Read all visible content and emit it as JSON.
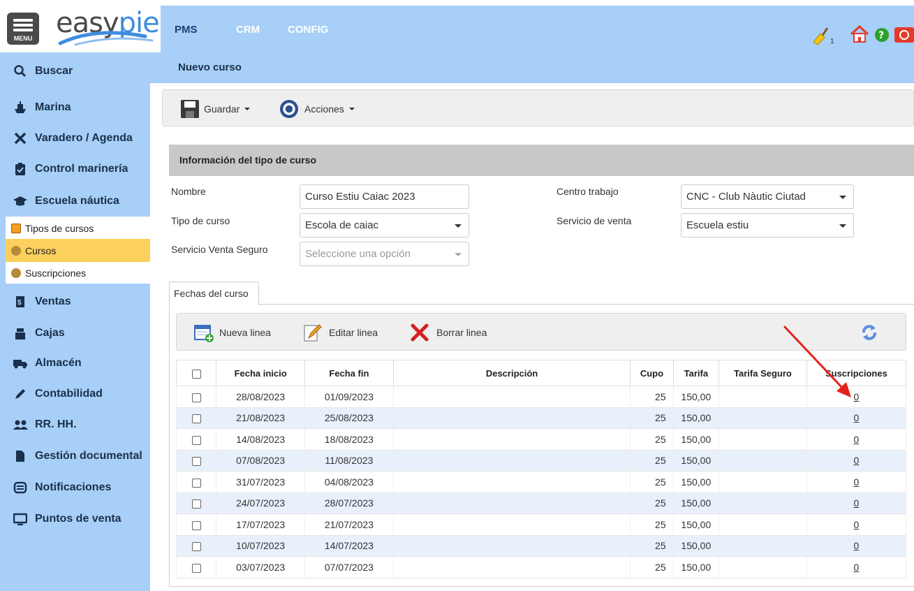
{
  "app": {
    "menu_label": "MENU",
    "logo_part1": "easy",
    "logo_part2": "pier",
    "modules": [
      "PMS",
      "CRM",
      "CONFIG"
    ],
    "notification_count": "1"
  },
  "sidebar": {
    "items": [
      {
        "label": "Buscar",
        "icon": "search-icon"
      },
      {
        "label": "Marina",
        "icon": "ship-icon"
      },
      {
        "label": "Varadero / Agenda",
        "icon": "tools-icon"
      },
      {
        "label": "Control marinería",
        "icon": "clipboard-icon"
      },
      {
        "label": "Escuela náutica",
        "icon": "graduation-cap-icon"
      },
      {
        "label": "Ventas",
        "icon": "receipt-icon"
      },
      {
        "label": "Cajas",
        "icon": "cash-register-icon"
      },
      {
        "label": "Almacén",
        "icon": "truck-icon"
      },
      {
        "label": "Contabilidad",
        "icon": "pen-icon"
      },
      {
        "label": "RR. HH.",
        "icon": "users-icon"
      },
      {
        "label": "Gestión documental",
        "icon": "file-icon"
      },
      {
        "label": "Notificaciones",
        "icon": "envelope-icon"
      },
      {
        "label": "Puntos de venta",
        "icon": "monitor-icon"
      }
    ],
    "subitems": [
      {
        "label": "Tipos de cursos",
        "icon": "course-type-icon"
      },
      {
        "label": "Cursos",
        "icon": "course-icon"
      },
      {
        "label": "Suscripciones",
        "icon": "subscription-icon"
      }
    ]
  },
  "page": {
    "title": "Nuevo curso"
  },
  "toolbar": {
    "save_label": "Guardar",
    "actions_label": "Acciones"
  },
  "form": {
    "section_title": "Información del tipo de curso",
    "nombre_label": "Nombre",
    "nombre_value": "Curso Estiu Caiac 2023",
    "tipo_label": "Tipo de curso",
    "tipo_value": "Escola de caiac",
    "seguro_label": "Servicio Venta Seguro",
    "seguro_placeholder": "Seleccione una opción",
    "centro_label": "Centro trabajo",
    "centro_value": "CNC - Club Nàutic Ciutad",
    "servicio_label": "Servicio de venta",
    "servicio_value": "Escuela estiu"
  },
  "tabs": {
    "fechas": "Fechas del curso"
  },
  "grid_toolbar": {
    "new_line": "Nueva linea",
    "edit_line": "Editar linea",
    "delete_line": "Borrar linea"
  },
  "table": {
    "headers": [
      "Fecha inicio",
      "Fecha fin",
      "Descripción",
      "Cupo",
      "Tarifa",
      "Tarifa Seguro",
      "Suscripciones"
    ],
    "rows": [
      [
        "28/08/2023",
        "01/09/2023",
        "",
        "25",
        "150,00",
        "",
        "0"
      ],
      [
        "21/08/2023",
        "25/08/2023",
        "",
        "25",
        "150,00",
        "",
        "0"
      ],
      [
        "14/08/2023",
        "18/08/2023",
        "",
        "25",
        "150,00",
        "",
        "0"
      ],
      [
        "07/08/2023",
        "11/08/2023",
        "",
        "25",
        "150,00",
        "",
        "0"
      ],
      [
        "31/07/2023",
        "04/08/2023",
        "",
        "25",
        "150,00",
        "",
        "0"
      ],
      [
        "24/07/2023",
        "28/07/2023",
        "",
        "25",
        "150,00",
        "",
        "0"
      ],
      [
        "17/07/2023",
        "21/07/2023",
        "",
        "25",
        "150,00",
        "",
        "0"
      ],
      [
        "10/07/2023",
        "14/07/2023",
        "",
        "25",
        "150,00",
        "",
        "0"
      ],
      [
        "03/07/2023",
        "07/07/2023",
        "",
        "25",
        "150,00",
        "",
        "0"
      ]
    ]
  },
  "colors": {
    "nav_bg": "#a7cff7",
    "active_item": "#fcd05c",
    "alt_row": "#e8f0fc",
    "annotation_arrow": "#e3231b"
  }
}
